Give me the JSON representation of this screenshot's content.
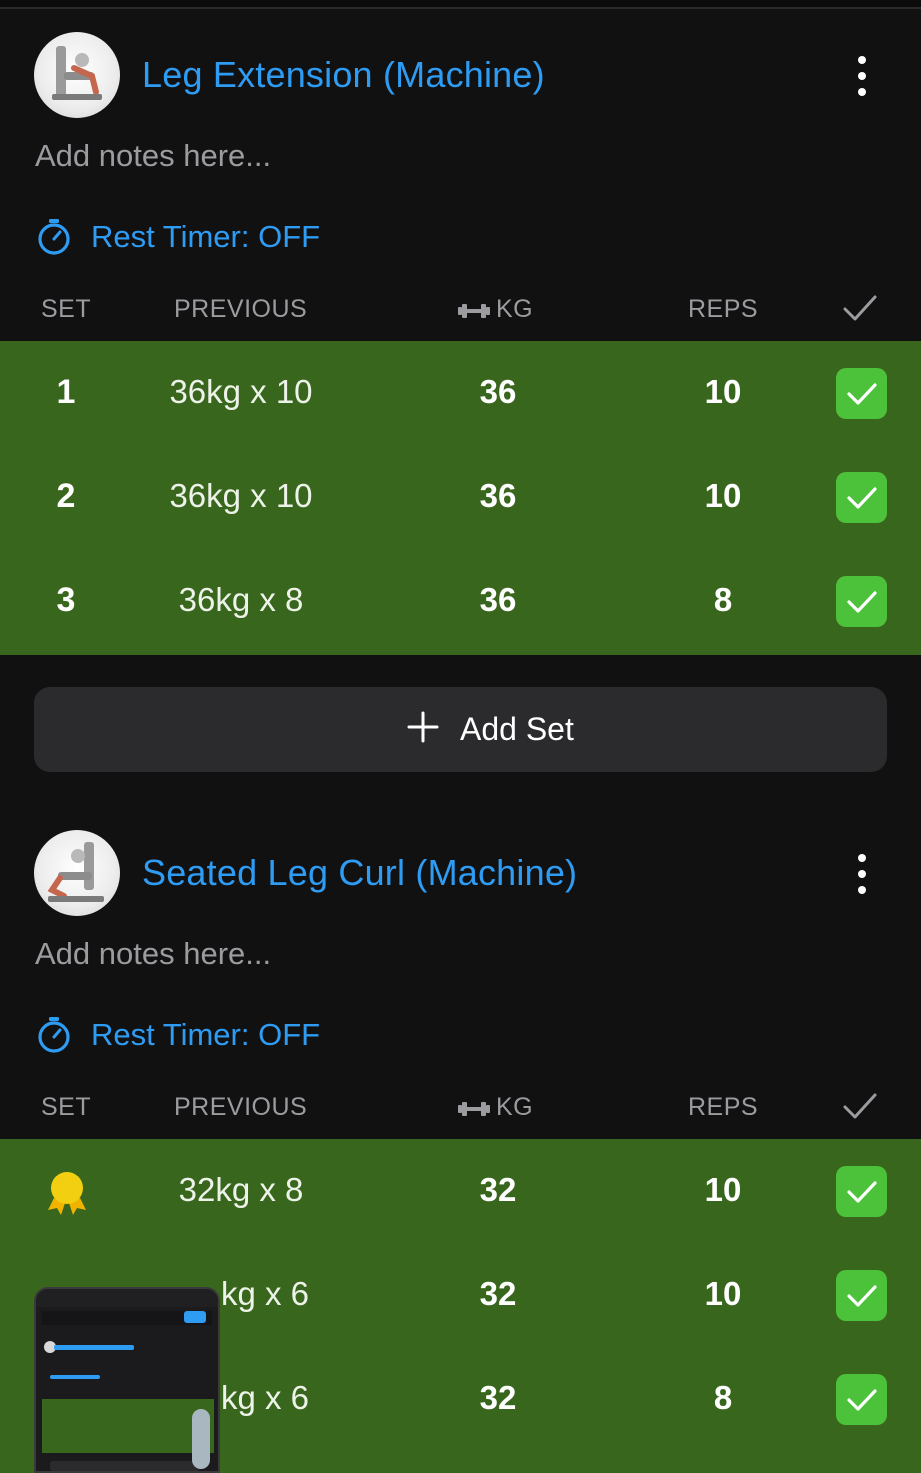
{
  "columns": {
    "set": "SET",
    "previous": "PREVIOUS",
    "kg": "KG",
    "reps": "REPS"
  },
  "add_set_label": "Add Set",
  "exercises": [
    {
      "title": "Leg Extension (Machine)",
      "notes_placeholder": "Add notes here...",
      "rest_timer": "Rest Timer: OFF",
      "sets": [
        {
          "set": "1",
          "previous": "36kg x 10",
          "kg": "36",
          "reps": "10",
          "completed": true
        },
        {
          "set": "2",
          "previous": "36kg x 10",
          "kg": "36",
          "reps": "10",
          "completed": true
        },
        {
          "set": "3",
          "previous": "36kg x 8",
          "kg": "36",
          "reps": "8",
          "completed": true
        }
      ]
    },
    {
      "title": "Seated Leg Curl (Machine)",
      "notes_placeholder": "Add notes here...",
      "rest_timer": "Rest Timer: OFF",
      "sets": [
        {
          "set": "",
          "set_icon": "medal-icon",
          "previous": "32kg x 8",
          "kg": "32",
          "reps": "10",
          "completed": true
        },
        {
          "set": "",
          "previous": "kg x 6",
          "kg": "32",
          "reps": "10",
          "completed": true
        },
        {
          "set": "",
          "previous": "kg x 6",
          "kg": "32",
          "reps": "8",
          "completed": true
        }
      ]
    }
  ],
  "colors": {
    "background": "#111112",
    "accent": "#2f9cf4",
    "completed_row": "#39661d",
    "check_box": "#4cc23a",
    "add_button": "#2b2b2e",
    "muted_text": "#9c9ca0"
  }
}
